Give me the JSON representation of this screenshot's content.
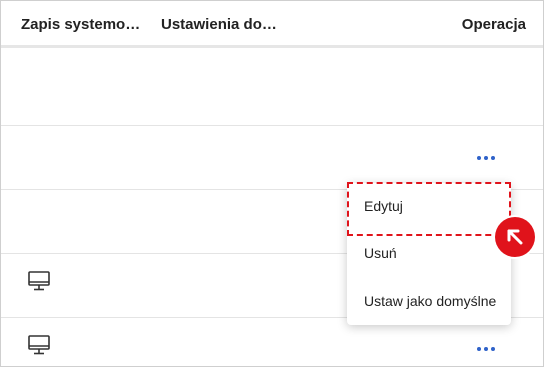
{
  "table": {
    "columns": [
      "Zapis systemo…",
      "Ustawienia do…",
      "Operacja"
    ],
    "rows": [
      {
        "icon": "",
        "has_actions": false
      },
      {
        "icon": "",
        "has_actions": true
      },
      {
        "icon": "",
        "has_actions": false
      },
      {
        "icon": "monitor-icon",
        "has_actions": false
      },
      {
        "icon": "monitor-icon",
        "has_actions": true
      }
    ]
  },
  "context_menu": {
    "items": [
      "Edytuj",
      "Usuń",
      "Ustaw jako domyślne"
    ]
  },
  "colors": {
    "accent_dots": "#2f62c9",
    "highlight": "#e0131b"
  }
}
